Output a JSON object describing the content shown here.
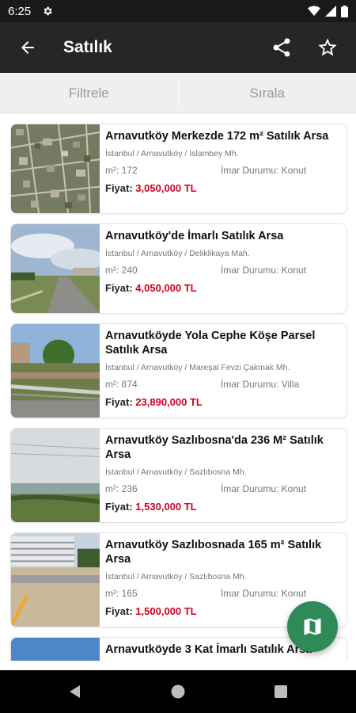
{
  "status_bar": {
    "time": "6:25",
    "icons": [
      "gear-icon",
      "wifi-icon",
      "signal-icon",
      "battery-icon"
    ]
  },
  "toolbar": {
    "title": "Satılık",
    "icons": [
      "back-arrow-icon",
      "share-icon",
      "star-icon"
    ]
  },
  "tabs": [
    {
      "label": "Filtrele"
    },
    {
      "label": "Sırala"
    }
  ],
  "listings": [
    {
      "title": "Arnavutköy Merkezde 172 m² Satılık Arsa",
      "location": "İstanbul / Arnavutköy / İslambey Mh.",
      "area": "m²: 172",
      "zoning": "İmar Durumu: Konut",
      "price_label": "Fiyat:",
      "price": "3,050,000 TL"
    },
    {
      "title": "Arnavutköy'de  İmarlı Satılık Arsa",
      "location": "İstanbul / Arnavutköy / Deliklikaya Mah.",
      "area": "m²: 240",
      "zoning": "İmar Durumu: Konut",
      "price_label": "Fiyat:",
      "price": "4,050,000 TL"
    },
    {
      "title": "Arnavutköyde Yola Cephe Köşe Parsel Satılık Arsa",
      "location": "İstanbul / Arnavutköy / Mareşal Fevzi Çakmak Mh.",
      "area": "m²: 874",
      "zoning": "İmar Durumu: Villa",
      "price_label": "Fiyat:",
      "price": "23,890,000 TL"
    },
    {
      "title": "Arnavutköy Sazlıbosna'da 236 M² Satılık Arsa",
      "location": "İstanbul / Arnavutköy / Sazlıbosna Mh.",
      "area": "m²: 236",
      "zoning": "İmar Durumu: Konut",
      "price_label": "Fiyat:",
      "price": "1,530,000 TL"
    },
    {
      "title": "Arnavutköy Sazlıbosnada 165 m² Satılık Arsa",
      "location": "İstanbul / Arnavutköy / Sazlıbosna Mh.",
      "area": "m²: 165",
      "zoning": "İmar Durumu: Konut",
      "price_label": "Fiyat:",
      "price": "1,500,000 TL"
    },
    {
      "title": "Arnavutköyde 3 Kat İmarlı Satılık Arsa"
    }
  ],
  "fab": {
    "icon": "map-icon"
  },
  "colors": {
    "toolbar": "#262626",
    "status_bar": "#1a1a1a",
    "price": "#d2001f",
    "fab": "#2e8a57",
    "tabs_bg": "#efefef"
  },
  "nav_bar": {
    "icons": [
      "back-nav-icon",
      "home-nav-icon",
      "recents-nav-icon"
    ]
  }
}
